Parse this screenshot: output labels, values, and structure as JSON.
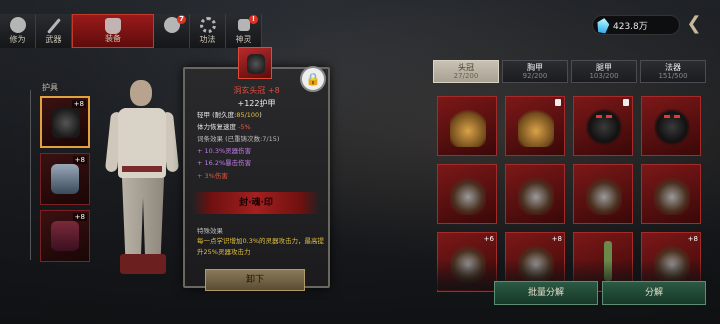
{
  "top_tabs": [
    {
      "label": "修为",
      "icon": "person-icon"
    },
    {
      "label": "武器",
      "icon": "sword-icon"
    },
    {
      "label": "装备",
      "icon": "robe-icon",
      "active": true
    },
    {
      "label": "",
      "icon": "figure-icon",
      "badge": "7"
    },
    {
      "label": "功法",
      "icon": "gear-icon"
    },
    {
      "label": "神灵",
      "icon": "lock-icon",
      "badge": "!"
    }
  ],
  "currency": {
    "value": "423.8万",
    "icon": "spirit-gem-icon"
  },
  "equipment": {
    "label": "护具",
    "slots": [
      {
        "name": "helmet",
        "level": "+8",
        "selected": true
      },
      {
        "name": "armor",
        "level": "+8"
      },
      {
        "name": "boots",
        "level": "+8"
      }
    ]
  },
  "tooltip": {
    "name": "洞玄头冠 +8",
    "main_stat": "+122护甲",
    "type_line": "轻甲",
    "durability_label": "(耐久度:",
    "durability_value": "85/100",
    "durability_close": ")",
    "stat_line": "体力恢复速度",
    "stat_value": "-5%",
    "affix_header": "词条效果 (已重铸次数:7/15)",
    "affixes": [
      "+ 10.3%灵器伤害",
      "+ 16.2%暴击伤害",
      "+ 3%伤害"
    ],
    "seal_text": "封·魂·印",
    "special_label": "特殊效果",
    "special_desc": "每一点学识增加0.3%的灵器攻击力，最高提升25%灵器攻击力",
    "unequip_label": "卸下"
  },
  "inventory_tabs": [
    {
      "label": "头冠",
      "count": "27/200",
      "active": true
    },
    {
      "label": "胸甲",
      "count": "92/200"
    },
    {
      "label": "腿甲",
      "count": "103/200"
    },
    {
      "label": "法器",
      "count": "151/500"
    }
  ],
  "inventory_items": [
    {
      "kind": "helmet-gold",
      "locked": false
    },
    {
      "kind": "helmet-gold",
      "locked": true
    },
    {
      "kind": "helmet-demon",
      "locked": true
    },
    {
      "kind": "helmet-demon",
      "locked": false
    },
    {
      "kind": "helmet-feather",
      "locked": false
    },
    {
      "kind": "helmet-feather",
      "locked": false
    },
    {
      "kind": "helmet-feather",
      "locked": false
    },
    {
      "kind": "helmet-feather",
      "locked": false
    },
    {
      "kind": "helmet-feather",
      "level": "+6"
    },
    {
      "kind": "helmet-feather",
      "level": "+8"
    },
    {
      "kind": "hairpin",
      "locked": false
    },
    {
      "kind": "helmet-feather",
      "level": "+8"
    }
  ],
  "buttons": {
    "bulk_decompose": "批量分解",
    "decompose": "分解"
  }
}
